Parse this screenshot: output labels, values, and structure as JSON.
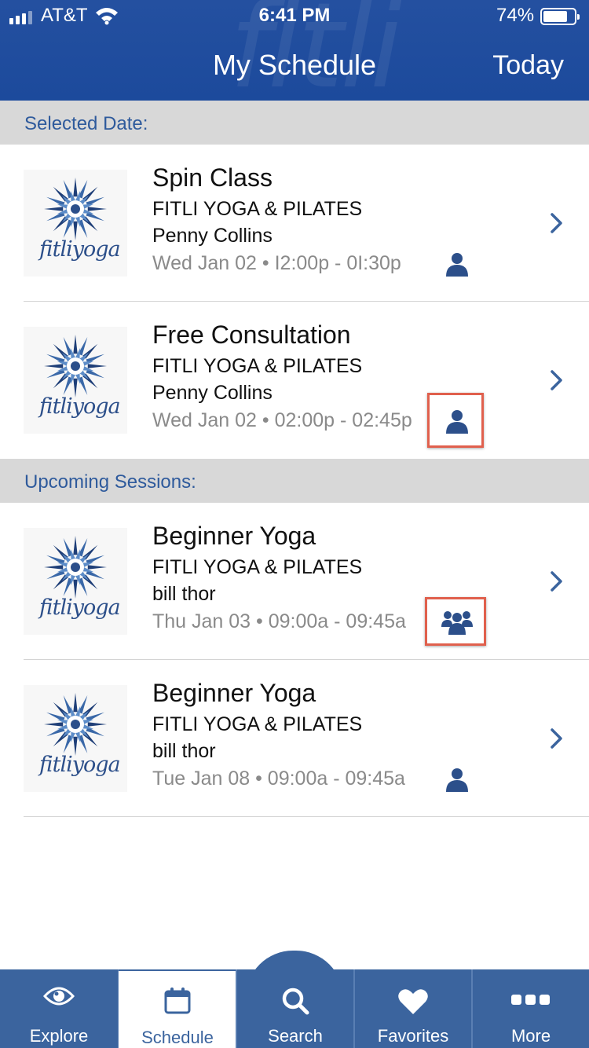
{
  "status_bar": {
    "carrier": "AT&T",
    "time": "6:41 PM",
    "battery": "74%"
  },
  "header": {
    "watermark": "fitli",
    "title": "My Schedule",
    "today_label": "Today"
  },
  "sections": {
    "selected_label": "Selected Date:",
    "upcoming_label": "Upcoming Sessions:"
  },
  "logo_text": "fitliyoga",
  "sessions": [
    {
      "title": "Spin Class",
      "studio": "FITLI YOGA & PILATES",
      "instructor": "Penny Collins",
      "when": "Wed Jan 02 • I2:00p - 0I:30p",
      "type_icon": "single-person-icon"
    },
    {
      "title": "Free Consultation",
      "studio": "FITLI YOGA & PILATES",
      "instructor": "Penny Collins",
      "when": "Wed Jan 02 • 02:00p - 02:45p",
      "type_icon": "single-person-icon"
    },
    {
      "title": "Beginner Yoga",
      "studio": "FITLI YOGA & PILATES",
      "instructor": "bill thor",
      "when": "Thu Jan 03 • 09:00a - 09:45a",
      "type_icon": "group-icon"
    },
    {
      "title": "Beginner Yoga",
      "studio": "FITLI YOGA & PILATES",
      "instructor": "bill thor",
      "when": "Tue Jan 08 • 09:00a - 09:45a",
      "type_icon": "single-person-icon"
    }
  ],
  "tabs": [
    {
      "label": "Explore",
      "icon": "eye-icon"
    },
    {
      "label": "Schedule",
      "icon": "calendar-icon",
      "active": true
    },
    {
      "label": "Search",
      "icon": "search-icon"
    },
    {
      "label": "Favorites",
      "icon": "heart-icon"
    },
    {
      "label": "More",
      "icon": "more-icon"
    }
  ],
  "colors": {
    "header_blue": "#1c4a9c",
    "tab_blue": "#3b649e",
    "icon_blue": "#2c4f8a",
    "highlight": "#e0604d"
  }
}
